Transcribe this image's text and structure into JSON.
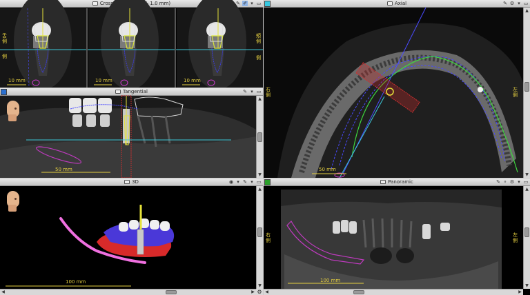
{
  "panels": {
    "cross": {
      "title": "Cross-sectionals(+/- 1.0 mm)",
      "scale_label": "10 mm",
      "left_tick_a": "舌",
      "left_tick_b": "側",
      "right_tick_a": "頬",
      "right_tick_b": "側"
    },
    "axial": {
      "title": "Axial",
      "scale_label": "50 mm",
      "left_tick_a": "右",
      "left_tick_b": "側",
      "right_tick_a": "左",
      "right_tick_b": "側",
      "color": "#37c8e0"
    },
    "tangential": {
      "title": "Tangential",
      "scale_label": "50 mm",
      "color": "#2a6fcf"
    },
    "three_d": {
      "title": "3D",
      "scale_label": "100 mm"
    },
    "panoramic": {
      "title": "Panoramic",
      "scale_label": "100 mm",
      "left_tick_a": "右",
      "left_tick_b": "側",
      "right_tick_a": "左",
      "right_tick_b": "側",
      "color": "#2aa02a"
    }
  },
  "icons": [
    "camera-icon",
    "wrench-icon",
    "pen-icon",
    "dropdown-icon",
    "maximize-icon",
    "head-orientation-icon",
    "gear-icon"
  ]
}
